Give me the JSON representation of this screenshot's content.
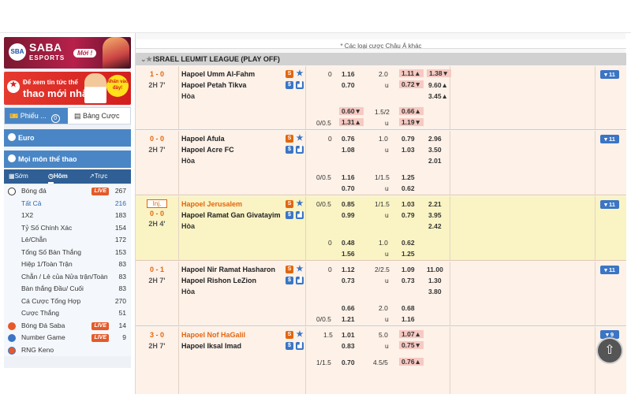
{
  "sidebar": {
    "banner_saba": {
      "logo": "SBA",
      "brand": "SABA",
      "sub": "ESPORTS",
      "badge": "Mới !"
    },
    "banner_news": {
      "line1": "Để xem tin tức thể",
      "line2": "thao mới nhất",
      "badge": "Nhấn vào đây!"
    },
    "tabs": {
      "ticket": "Phiếu ...",
      "ticket_count": "0",
      "board": "Bảng Cược"
    },
    "sections": {
      "euro": "Euro",
      "all_sports": "Mọi môn thể thao"
    },
    "time_tabs": {
      "early": "Sớm",
      "today": "Hôm ...",
      "live": "Trực tiếp"
    },
    "sports": [
      {
        "label": "Bóng đá",
        "count": "267",
        "live": "LIVE"
      },
      {
        "label": "Tất Cả",
        "count": "216"
      },
      {
        "label": "1X2",
        "count": "183"
      },
      {
        "label": "Tỷ Số Chính Xác",
        "count": "154"
      },
      {
        "label": "Lẻ/Chẵn",
        "count": "172"
      },
      {
        "label": "Tổng Số Bàn Thắng",
        "count": "153"
      },
      {
        "label": "Hiệp 1/Toàn Trận",
        "count": "83"
      },
      {
        "label": "Chẵn / Lẻ của Nửa trận/Toàn",
        "count": "83"
      },
      {
        "label": "Bàn thắng Đầu/ Cuối",
        "count": "83"
      },
      {
        "label": "Cá Cược Tổng Hợp",
        "count": "270"
      },
      {
        "label": "Cược Thắng",
        "count": "51"
      },
      {
        "label": "Bóng Đá Saba",
        "count": "14",
        "live": "LIVE"
      },
      {
        "label": "Number Game",
        "count": "9",
        "live": "LIVE"
      },
      {
        "label": "RNG Keno",
        "count": ""
      }
    ]
  },
  "main": {
    "asian_note": "* Các loại cược Châu Á khác",
    "league": "ISRAEL LEUMIT LEAGUE (PLAY OFF)",
    "matches": [
      {
        "score": "1 - 0",
        "clock": "2H 7'",
        "home": "Hapoel Umm Al-Fahm",
        "away": "Hapoel Petah Tikva",
        "draw": "Hòa",
        "more": "▾ 11",
        "r1": {
          "hdp": "0",
          "h_odds": "1.16",
          "ou": "2.0",
          "o_odds": "1.11▲",
          "x12": "1.38▼"
        },
        "r2": {
          "h_odds": "0.70",
          "u": "u",
          "o_odds": "0.72▼",
          "x12": "9.60▲"
        },
        "r3": {
          "x12": "3.45▲"
        },
        "r4": {
          "hdp": "",
          "h_odds": "0.60▼",
          "ou": "1.5/2",
          "o_odds": "0.66▲"
        },
        "r5": {
          "hdp": "0/0.5",
          "h_odds": "1.31▲",
          "u": "u",
          "o_odds": "1.19▼"
        }
      },
      {
        "score": "0 - 0",
        "clock": "2H 7'",
        "home": "Hapoel Afula",
        "away": "Hapoel Acre FC",
        "draw": "Hòa",
        "more": "▾ 11",
        "r1": {
          "hdp": "0",
          "h_odds": "0.76",
          "ou": "1.0",
          "o_odds": "0.79",
          "x12": "2.96"
        },
        "r2": {
          "h_odds": "1.08",
          "u": "u",
          "o_odds": "1.03",
          "x12": "3.50"
        },
        "r3": {
          "x12": "2.01"
        },
        "r4": {
          "hdp": "0/0.5",
          "h_odds": "1.16",
          "ou": "1/1.5",
          "o_odds": "1.25"
        },
        "r5": {
          "h_odds": "0.70",
          "u": "u",
          "o_odds": "0.62"
        }
      },
      {
        "inj": "Inj.",
        "score": "0 - 0",
        "clock": "2H 4'",
        "home": "Hapoel Jerusalem",
        "away": "Hapoel Ramat Gan Givatayim",
        "draw": "Hòa",
        "more": "▾ 11",
        "r1": {
          "hdp": "0/0.5",
          "h_odds": "0.85",
          "ou": "1/1.5",
          "o_odds": "1.03",
          "x12": "2.21"
        },
        "r2": {
          "h_odds": "0.99",
          "u": "u",
          "o_odds": "0.79",
          "x12": "3.95"
        },
        "r3": {
          "x12": "2.42"
        },
        "r4": {
          "hdp": "0",
          "h_odds": "0.48",
          "ou": "1.0",
          "o_odds": "0.62"
        },
        "r5": {
          "h_odds": "1.56",
          "u": "u",
          "o_odds": "1.25"
        }
      },
      {
        "score": "0 - 1",
        "clock": "2H 7'",
        "home": "Hapoel Nir Ramat Hasharon",
        "away": "Hapoel Rishon LeZion",
        "draw": "Hòa",
        "more": "▾ 11",
        "r1": {
          "hdp": "0",
          "h_odds": "1.12",
          "ou": "2/2.5",
          "o_odds": "1.09",
          "x12": "11.00"
        },
        "r2": {
          "h_odds": "0.73",
          "u": "u",
          "o_odds": "0.73",
          "x12": "1.30"
        },
        "r3": {
          "x12": "3.80"
        },
        "r4": {
          "hdp": "",
          "h_odds": "0.66",
          "ou": "2.0",
          "o_odds": "0.68"
        },
        "r5": {
          "hdp": "0/0.5",
          "h_odds": "1.21",
          "u": "u",
          "o_odds": "1.16"
        }
      },
      {
        "score": "3 - 0",
        "clock": "2H 7'",
        "home": "Hapoel Nof HaGalil",
        "away": "Hapoel Iksal Imad",
        "more": "▾ 9",
        "r1": {
          "hdp": "1.5",
          "h_odds": "1.01",
          "ou": "5.0",
          "o_odds": "1.07▲"
        },
        "r2": {
          "h_odds": "0.83",
          "u": "u",
          "o_odds": "0.75▼"
        },
        "r4": {
          "hdp": "1/1.5",
          "h_odds": "0.70",
          "ou": "4.5/5",
          "o_odds": "0.76▲"
        }
      }
    ]
  },
  "colors": {
    "brand_blue": "#4a86c5",
    "live_orange": "#e55a2a",
    "fav_orange": "#e2660f",
    "highlight_row": "#faf3c4",
    "odds_highlight": "#f6c9c2"
  },
  "icons": [
    "stats-icon",
    "star-icon",
    "s-icon",
    "chart-icon",
    "back-to-top-icon",
    "soccer-icon",
    "ticket-icon"
  ]
}
